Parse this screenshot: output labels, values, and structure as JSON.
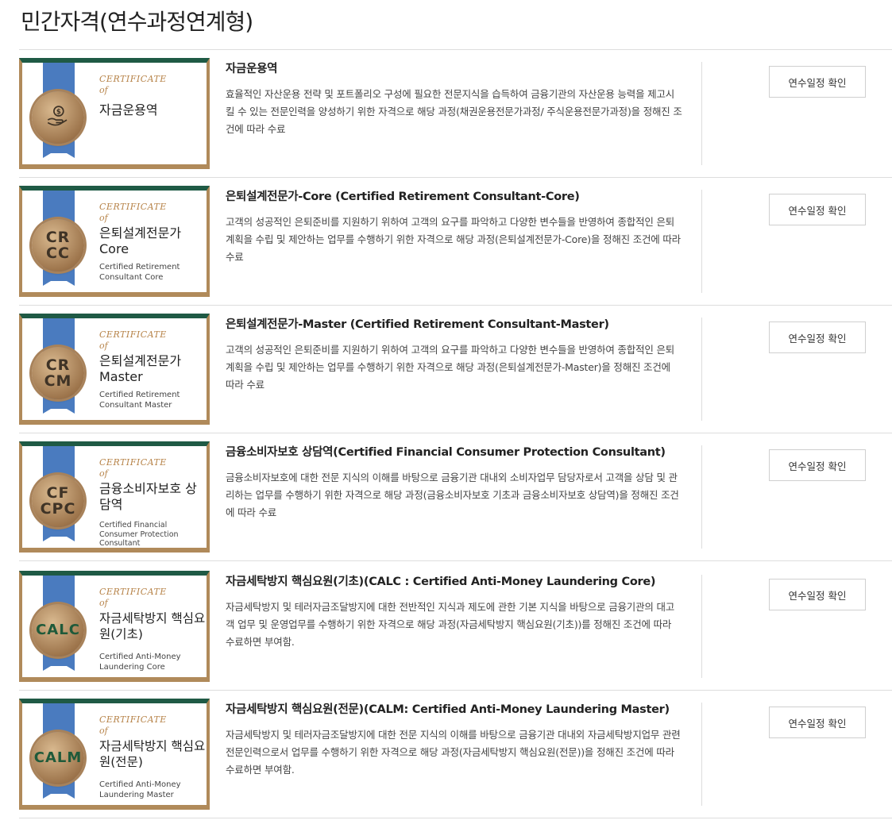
{
  "page": {
    "title": "민간자격(연수과정연계형)"
  },
  "certificates": [
    {
      "card": {
        "heading": "CERTIFICATE",
        "of": "of",
        "name": "자금운용역",
        "sub": "",
        "seal": "",
        "seal_icon": "money-hand-icon"
      },
      "title": "자금운용역",
      "description": "효율적인 자산운용 전략 및 포트폴리오 구성에 필요한 전문지식을 습득하여 금융기관의 자산운용 능력을 제고시킬 수 있는 전문인력을 양성하기 위한 자격으로 해당 과정(채권운용전문가과정/ 주식운용전문가과정)을 정해진 조건에 따라 수료",
      "button": "연수일정 확인"
    },
    {
      "card": {
        "heading": "CERTIFICATE",
        "of": "of",
        "name": "은퇴설계전문가 Core",
        "sub": "Certified Retirement Consultant Core",
        "seal": "CR\nCC",
        "seal_icon": ""
      },
      "title": "은퇴설계전문가-Core (Certified Retirement Consultant-Core)",
      "description": "고객의 성공적인 은퇴준비를 지원하기 위하여 고객의 요구를 파악하고 다양한 변수들을 반영하여 종합적인 은퇴계획을 수립 및 제안하는 업무를 수행하기 위한 자격으로 해당 과정(은퇴설계전문가-Core)을 정해진 조건에 따라 수료",
      "button": "연수일정 확인"
    },
    {
      "card": {
        "heading": "CERTIFICATE",
        "of": "of",
        "name": "은퇴설계전문가 Master",
        "sub": "Certified Retirement Consultant Master",
        "seal": "CR\nCM",
        "seal_icon": ""
      },
      "title": "은퇴설계전문가-Master (Certified Retirement Consultant-Master)",
      "description": "고객의 성공적인 은퇴준비를 지원하기 위하여 고객의 요구를 파악하고 다양한 변수들을 반영하여 종합적인 은퇴계획을 수립 및 제안하는 업무를 수행하기 위한 자격으로 해당 과정(은퇴설계전문가-Master)을 정해진 조건에 따라 수료",
      "button": "연수일정 확인"
    },
    {
      "card": {
        "heading": "CERTIFICATE",
        "of": "of",
        "name": "금융소비자보호 상담역",
        "sub": "Certified Financial Consumer Protection Consultant",
        "seal": "CF\nCPC",
        "seal_icon": ""
      },
      "title": "금융소비자보호 상담역(Certified Financial Consumer Protection Consultant)",
      "description": "금융소비자보호에 대한 전문 지식의 이해를 바탕으로 금융기관 대내외 소비자업무 담당자로서 고객을 상담 및 관리하는 업무를 수행하기 위한 자격으로 해당 과정(금융소비자보호 기초과 금융소비자보호 상담역)을 정해진 조건에 따라 수료",
      "button": "연수일정 확인"
    },
    {
      "card": {
        "heading": "CERTIFICATE",
        "of": "of",
        "name": "자금세탁방지 핵심요원(기초)",
        "sub": "Certified Anti-Money Laundering Core",
        "seal": "CALC",
        "seal_icon": ""
      },
      "title": "자금세탁방지 핵심요원(기초)(CALC : Certified Anti-Money Laundering Core)",
      "description": "자금세탁방지 및 테러자금조달방지에 대한 전반적인 지식과 제도에 관한 기본 지식을 바탕으로 금융기관의 대고객 업무 및 운영업무를 수행하기 위한 자격으로 해당 과정(자금세탁방지 핵심요원(기초))를 정해진 조건에 따라 수료하면 부여함.",
      "button": "연수일정 확인"
    },
    {
      "card": {
        "heading": "CERTIFICATE",
        "of": "of",
        "name": "자금세탁방지 핵심요원(전문)",
        "sub": "Certified Anti-Money Laundering Master",
        "seal": "CALM",
        "seal_icon": ""
      },
      "title": "자금세탁방지 핵심요원(전문)(CALM: Certified Anti-Money Laundering Master)",
      "description": "자금세탁방지 및 테러자금조달방지에 대한 전문 지식의 이해를 바탕으로 금융기관 대내외 자금세탁방지업무 관련 전문인력으로서 업무를 수행하기 위한 자격으로 해당 과정(자금세탁방지 핵심요원(전문))을 정해진 조건에 따라 수료하면 부여함.",
      "button": "연수일정 확인"
    }
  ]
}
